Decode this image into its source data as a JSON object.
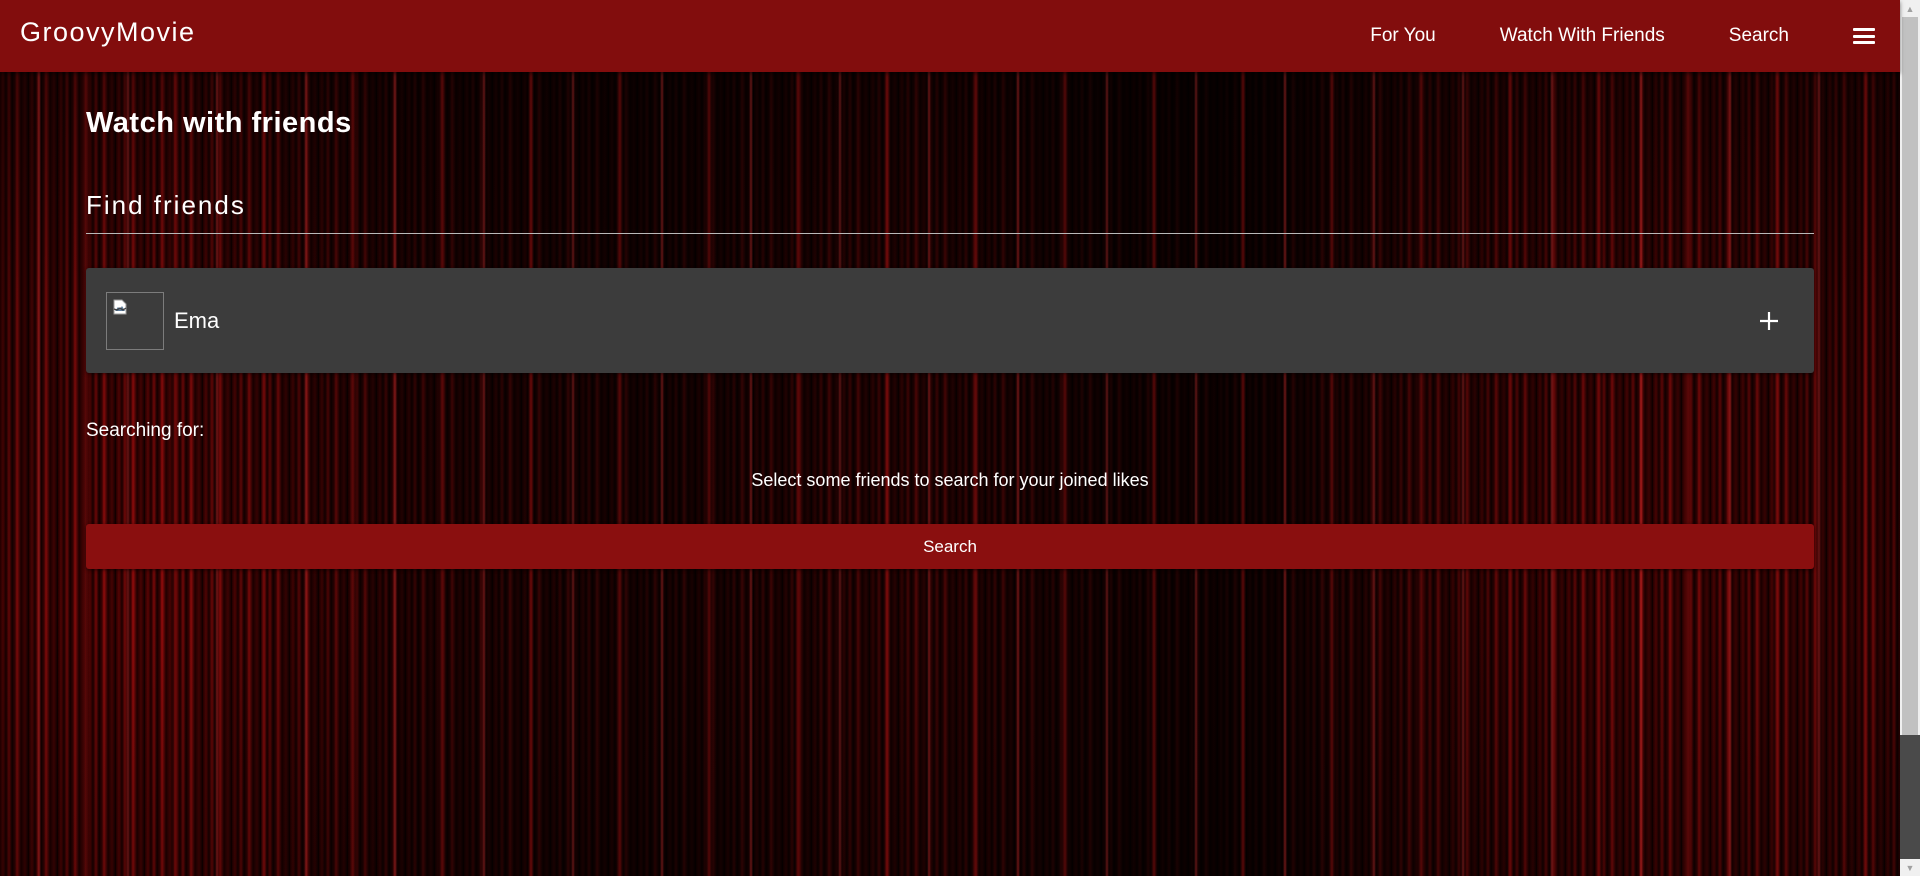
{
  "brand": {
    "name": "GroovyMovie"
  },
  "nav": {
    "items": [
      "For You",
      "Watch With Friends",
      "Search"
    ],
    "menu_icon": "hamburger-menu-icon"
  },
  "main": {
    "title": "Watch with friends",
    "find_section": {
      "title": "Find friends"
    },
    "friends": [
      {
        "name": "Ema",
        "avatar_icon": "broken-image-icon",
        "action_icon": "plus-icon"
      }
    ],
    "searching_label": "Searching for:",
    "empty_hint": "Select some friends to search for your joined likes",
    "search_button_label": "Search"
  },
  "colors": {
    "navbar": "#820d0d",
    "card": "#3c3c3c",
    "button": "#8a0f0f",
    "text": "#ffffff"
  }
}
